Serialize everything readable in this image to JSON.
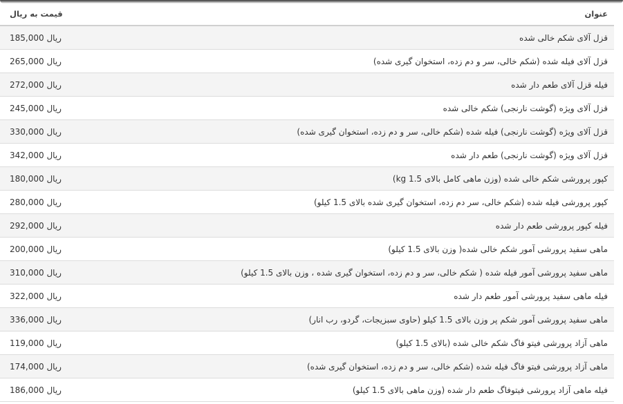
{
  "table": {
    "headers": {
      "title": "عنوان",
      "price": "قیمت به ریال"
    },
    "rows": [
      {
        "title": "قزل آلای شکم خالی شده",
        "price": "185,000 ریال"
      },
      {
        "title": "قزل آلای فیله شده (شکم خالی، سر و دم زده، استخوان گیری شده)",
        "price": "265,000 ریال"
      },
      {
        "title": "فیله قزل آلای طعم دار شده",
        "price": "272,000 ریال"
      },
      {
        "title": "قزل آلای ویژه (گوشت نارنجی) شکم خالی شده",
        "price": "245,000 ریال"
      },
      {
        "title": "قزل آلای ویژه (گوشت نارنجی) فیله شده (شکم خالی، سر و دم زده، استخوان گیری شده)",
        "price": "330,000 ریال"
      },
      {
        "title": "قزل آلای ویژه (گوشت نارنجی) طعم دار شده",
        "price": "342,000 ریال"
      },
      {
        "title": "کپور پرورشی شکم خالی شده (وزن ماهی کامل بالای 1.5 kg)",
        "price": "180,000 ریال"
      },
      {
        "title": "کپور پرورشی فیله شده (شکم خالی، سر دم زده، استخوان گیری شده بالای 1.5 کیلو)",
        "price": "280,000 ریال"
      },
      {
        "title": "فیله کپور پرورشی طعم دار شده",
        "price": "292,000 ریال"
      },
      {
        "title": "ماهی سفید پرورشی آمور شکم خالی شده( وزن بالای 1.5 کیلو)",
        "price": "200,000 ریال"
      },
      {
        "title": "ماهی سفید پرورشی آمور فیله شده ( شکم خالی، سر و دم زده، استخوان گیری شده ، وزن بالای 1.5 کیلو)",
        "price": "310,000 ریال"
      },
      {
        "title": "فیله ماهی سفید پرورشی آمور طعم دار شده",
        "price": "322,000 ریال"
      },
      {
        "title": "ماهی سفید پرورشی آمور شکم پر وزن بالای 1.5 کیلو (حاوی سبزیجات، گردو، رب انار)",
        "price": "336,000 ریال"
      },
      {
        "title": "ماهی آزاد پرورشی فیتو فاگ شکم خالی شده (بالای 1.5 کیلو)",
        "price": "119,000 ریال"
      },
      {
        "title": "ماهی آزاد پرورشی فیتو فاگ فیله شده (شکم خالی، سر و دم زده، استخوان گیری شده)",
        "price": "174,000 ریال"
      },
      {
        "title": "فیله ماهی آزاد پرورشی فیتوفاگ طعم دار شده (وزن ماهی بالای 1.5 کیلو)",
        "price": "186,000 ریال"
      }
    ]
  }
}
